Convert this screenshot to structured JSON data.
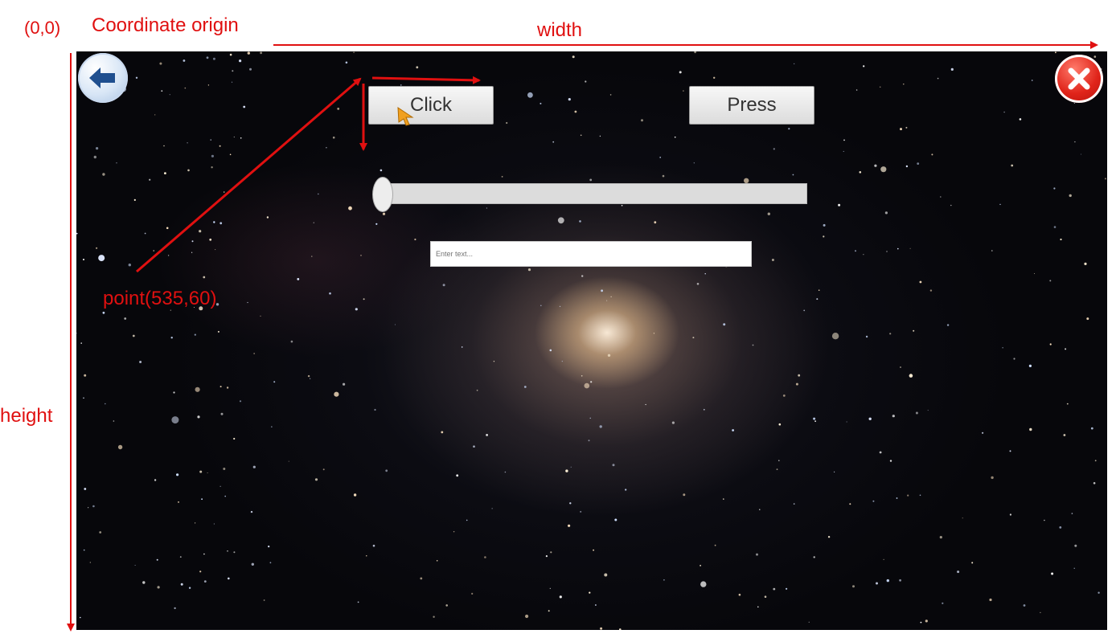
{
  "annotations": {
    "origin_coords": "(0,0)",
    "origin_label": "Coordinate origin",
    "width_label": "width",
    "height_label": "height",
    "point_label": "point(535,60)"
  },
  "toolbar": {
    "back_icon": "back-arrow-icon",
    "close_icon": "close-icon"
  },
  "buttons": {
    "click_label": "Click",
    "press_label": "Press"
  },
  "slider": {
    "value": 0
  },
  "input": {
    "placeholder": "Enter text...",
    "value": ""
  },
  "colors": {
    "annotation": "#e01010",
    "close_button": "#e0241a",
    "back_button": "#1f4f8f"
  }
}
